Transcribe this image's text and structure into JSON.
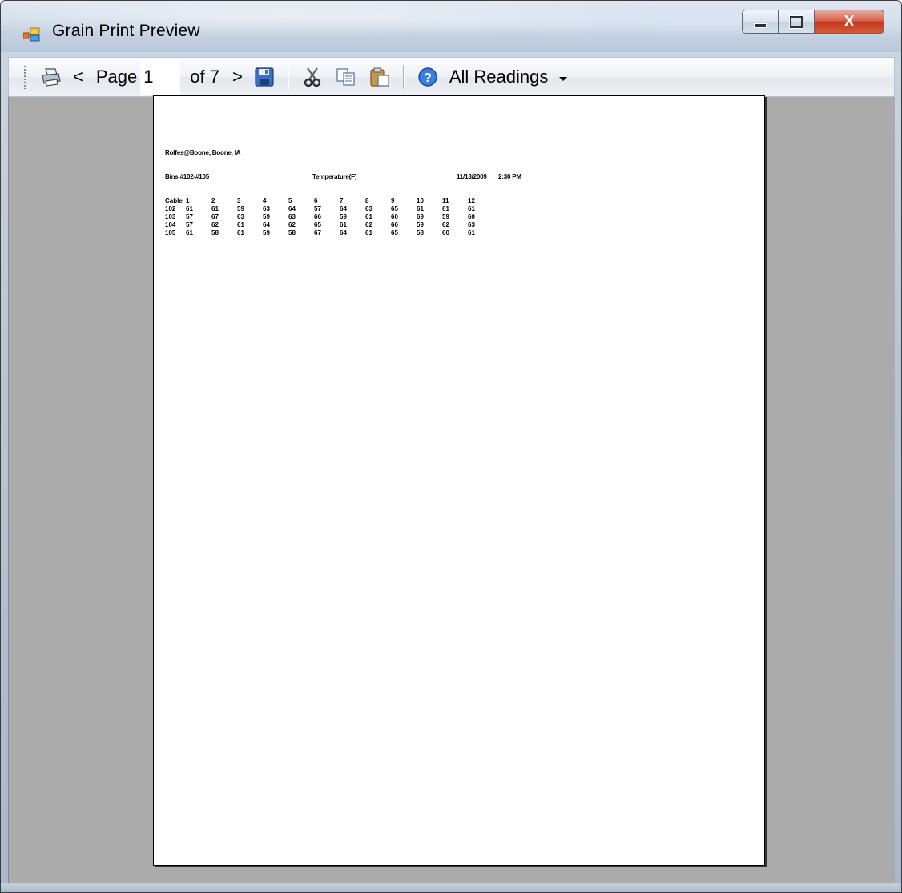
{
  "window": {
    "title": "Grain Print Preview",
    "close_symbol": "X"
  },
  "toolbar": {
    "print_icon": "printer-icon",
    "prev_label": "<",
    "page_label": "Page",
    "page_value": "1",
    "of_label": "of 7",
    "next_label": ">",
    "save_icon": "floppy-disk-icon",
    "cut_icon": "scissors-icon",
    "copy_icon": "copy-icon",
    "paste_icon": "paste-icon",
    "help_icon": "help-icon",
    "view_selected": "All Readings"
  },
  "report": {
    "location": "Rolfes@Boone, Boone, IA",
    "bins": "Bins #102-#105",
    "measure": "Temperature(F)",
    "date": "11/13/2009",
    "time": "2:30 PM",
    "columns": [
      "Cable",
      "1",
      "2",
      "3",
      "4",
      "5",
      "6",
      "7",
      "8",
      "9",
      "10",
      "11",
      "12"
    ],
    "rows": [
      [
        "102",
        "61",
        "61",
        "59",
        "63",
        "64",
        "57",
        "64",
        "63",
        "65",
        "61",
        "61",
        "61"
      ],
      [
        "103",
        "57",
        "67",
        "63",
        "59",
        "63",
        "66",
        "59",
        "61",
        "60",
        "69",
        "59",
        "60"
      ],
      [
        "104",
        "57",
        "62",
        "61",
        "64",
        "62",
        "65",
        "61",
        "62",
        "66",
        "59",
        "62",
        "63"
      ],
      [
        "105",
        "61",
        "58",
        "61",
        "59",
        "58",
        "67",
        "64",
        "61",
        "65",
        "58",
        "60",
        "61"
      ]
    ]
  },
  "colors": {
    "preview_background": "#ababab",
    "close_button": "#c3381c"
  }
}
